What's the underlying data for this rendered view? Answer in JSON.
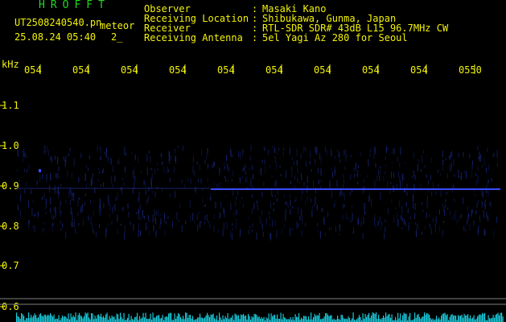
{
  "brand": "HROFFT",
  "file": {
    "name": "UT2508240540.pn",
    "type": "meteor",
    "date": "25.08.24 05:40",
    "index": "2_"
  },
  "info": {
    "labels": [
      "Observer",
      "Receiving Location",
      "Receiver",
      "Receiving Antenna"
    ],
    "separator": ":",
    "values": [
      "Masaki Kano",
      "Shibukawa, Gunma, Japan",
      "RTL-SDR SDR# 43dB L15 96.7MHz CW",
      "5el Yagi Az 280 for Seoul"
    ]
  },
  "axis": {
    "unit": "kHz",
    "y_ticks": [
      "1.1",
      "1.0",
      "0.9",
      "0.8",
      "0.7",
      "0.6"
    ],
    "x_ticks": [
      "054",
      "054",
      "054",
      "054",
      "054",
      "054",
      "054",
      "054",
      "054",
      "0550"
    ]
  },
  "colors": {
    "text_yellow": "#f2f20a",
    "brand_green": "#1fd81f",
    "signal_blue": "#3a4cff",
    "noise_cyan": "#19c8d8",
    "grid": "#3a3a3a"
  }
}
